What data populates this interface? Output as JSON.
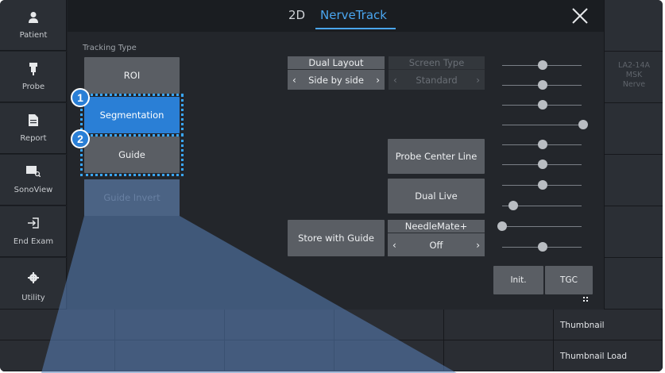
{
  "header": {
    "tab_2d": "2D",
    "tab_nervetrack": "NerveTrack",
    "close_icon": "close-x-icon"
  },
  "sidebar": {
    "items": [
      {
        "label": "Patient",
        "icon": "person-icon"
      },
      {
        "label": "Probe",
        "icon": "probe-icon"
      },
      {
        "label": "Report",
        "icon": "document-icon"
      },
      {
        "label": "SonoView",
        "icon": "image-search-icon"
      },
      {
        "label": "End Exam",
        "icon": "exit-icon"
      },
      {
        "label": "Utility",
        "icon": "gear-icon"
      }
    ]
  },
  "tracking": {
    "label": "Tracking Type",
    "roi": "ROI",
    "segmentation": "Segmentation",
    "guide": "Guide",
    "guide_invert": "Guide Invert",
    "badge1": "1",
    "badge2": "2"
  },
  "dual_layout": {
    "label": "Dual Layout",
    "value": "Side by side"
  },
  "screen_type": {
    "label": "Screen Type",
    "value": "Standard"
  },
  "buttons": {
    "probe_center_line": "Probe Center Line",
    "dual_live": "Dual Live",
    "store_with_guide": "Store with Guide",
    "init": "Init.",
    "tgc": "TGC"
  },
  "needlemate": {
    "label": "NeedleMate+",
    "value": "Off"
  },
  "probe_info": {
    "line1": "LA2-14A",
    "line2": "MSK",
    "line3": "Nerve"
  },
  "bottom": {
    "thumbnail": "Thumbnail",
    "thumbnail_load": "Thumbnail Load"
  },
  "colors": {
    "accent": "#2a7fd6",
    "tab_active": "#4aa6f0",
    "highlight": "#39a7ff"
  }
}
